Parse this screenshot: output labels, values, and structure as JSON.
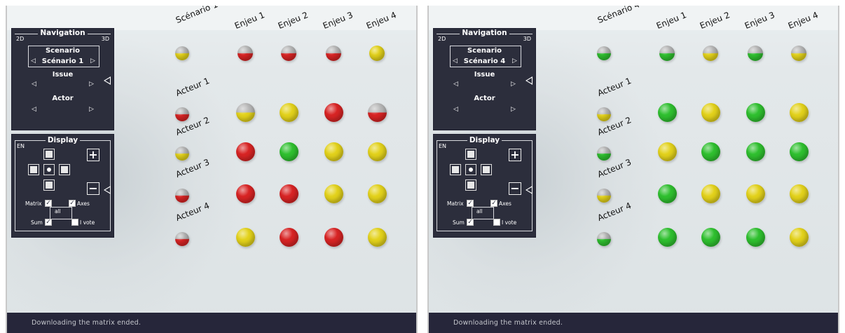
{
  "status_text": "Downloading the matrix ended.",
  "navigation": {
    "title": "Navigation",
    "left_label": "2D",
    "right_label": "3D",
    "scenario_label": "Scenario",
    "issue_label": "Issue",
    "actor_label": "Actor",
    "prev_glyph": "◁",
    "next_glyph": "▷"
  },
  "display": {
    "title": "Display",
    "lang": "EN",
    "plus": "+",
    "minus": "−",
    "matrix_label": "Matrix",
    "axes_label": "Axes",
    "all_label": "all",
    "sum_label": "Sum",
    "ivote_label": "I vote",
    "check_glyph": "✓"
  },
  "colors": {
    "red": "#d82424",
    "yellow": "#e3d21b",
    "green": "#2fc02f",
    "grey": "#b8b8b8"
  },
  "panels": [
    {
      "scenario_value": "Scénario 1",
      "columns": [
        "Scénario 1",
        "Enjeu 1",
        "Enjeu 2",
        "Enjeu 3",
        "Enjeu 4"
      ],
      "header_balls": [
        [
          "grey",
          "yellow"
        ],
        [
          "grey",
          "red"
        ],
        [
          "grey",
          "red"
        ],
        [
          "grey",
          "red"
        ],
        [
          "yellow",
          "yellow"
        ]
      ],
      "rows": [
        {
          "label": "Acteur 1",
          "first": [
            "grey",
            "red"
          ],
          "cells": [
            [
              "grey",
              "yellow"
            ],
            [
              "yellow",
              "yellow"
            ],
            [
              "red",
              "red"
            ],
            [
              "grey",
              "red"
            ]
          ]
        },
        {
          "label": "Acteur 2",
          "first": [
            "grey",
            "yellow"
          ],
          "cells": [
            [
              "red",
              "red"
            ],
            [
              "green",
              "green"
            ],
            [
              "yellow",
              "yellow"
            ],
            [
              "yellow",
              "yellow"
            ]
          ]
        },
        {
          "label": "Acteur 3",
          "first": [
            "grey",
            "red"
          ],
          "cells": [
            [
              "red",
              "red"
            ],
            [
              "red",
              "red"
            ],
            [
              "yellow",
              "yellow"
            ],
            [
              "yellow",
              "yellow"
            ]
          ]
        },
        {
          "label": "Acteur 4",
          "first": [
            "grey",
            "red"
          ],
          "cells": [
            [
              "yellow",
              "yellow"
            ],
            [
              "red",
              "red"
            ],
            [
              "red",
              "red"
            ],
            [
              "yellow",
              "yellow"
            ]
          ]
        }
      ]
    },
    {
      "scenario_value": "Scénario 4",
      "columns": [
        "Scénario 4",
        "Enjeu 1",
        "Enjeu 2",
        "Enjeu 3",
        "Enjeu 4"
      ],
      "header_balls": [
        [
          "grey",
          "green"
        ],
        [
          "grey",
          "green"
        ],
        [
          "grey",
          "yellow"
        ],
        [
          "grey",
          "green"
        ],
        [
          "grey",
          "yellow"
        ]
      ],
      "rows": [
        {
          "label": "Acteur 1",
          "first": [
            "grey",
            "yellow"
          ],
          "cells": [
            [
              "green",
              "green"
            ],
            [
              "yellow",
              "yellow"
            ],
            [
              "green",
              "green"
            ],
            [
              "yellow",
              "yellow"
            ]
          ]
        },
        {
          "label": "Acteur 2",
          "first": [
            "grey",
            "green"
          ],
          "cells": [
            [
              "yellow",
              "yellow"
            ],
            [
              "green",
              "green"
            ],
            [
              "green",
              "green"
            ],
            [
              "green",
              "green"
            ]
          ]
        },
        {
          "label": "Acteur 3",
          "first": [
            "grey",
            "yellow"
          ],
          "cells": [
            [
              "green",
              "green"
            ],
            [
              "yellow",
              "yellow"
            ],
            [
              "yellow",
              "yellow"
            ],
            [
              "yellow",
              "yellow"
            ]
          ]
        },
        {
          "label": "Acteur 4",
          "first": [
            "grey",
            "green"
          ],
          "cells": [
            [
              "green",
              "green"
            ],
            [
              "green",
              "green"
            ],
            [
              "green",
              "green"
            ],
            [
              "yellow",
              "yellow"
            ]
          ]
        }
      ]
    }
  ]
}
